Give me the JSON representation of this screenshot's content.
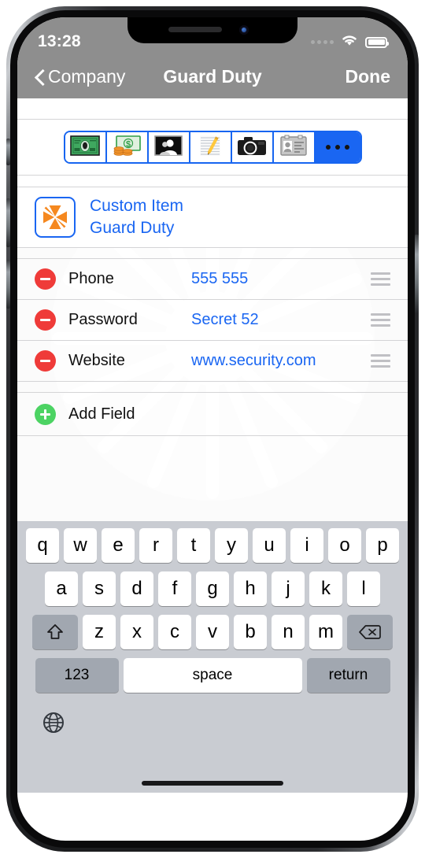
{
  "status_bar": {
    "time": "13:28",
    "signal_icon": "signal-dots-icon",
    "wifi_icon": "wifi-icon",
    "battery_icon": "battery-full-icon"
  },
  "nav_bar": {
    "back_label": "Company",
    "back_icon": "chevron-left-icon",
    "title": "Guard Duty",
    "done_label": "Done"
  },
  "segmented_control": {
    "segments": [
      {
        "name": "banknote-portrait-icon",
        "label": "",
        "selected": false
      },
      {
        "name": "cash-coins-icon",
        "label": "",
        "selected": false
      },
      {
        "name": "portrait-photo-icon",
        "label": "",
        "selected": false
      },
      {
        "name": "notepad-pencil-icon",
        "label": "",
        "selected": false
      },
      {
        "name": "camera-icon",
        "label": "",
        "selected": false
      },
      {
        "name": "id-card-icon",
        "label": "",
        "selected": false
      },
      {
        "name": "more-dots-icon",
        "label": "...",
        "selected": true
      }
    ]
  },
  "custom_item": {
    "icon": "orange-pinwheel-icon",
    "type_label": "Custom Item",
    "name_label": "Guard Duty"
  },
  "fields": {
    "rows": [
      {
        "delete_icon": "minus-circle-icon",
        "label": "Phone",
        "value": "555 555",
        "handle_icon": "reorder-handle-icon"
      },
      {
        "delete_icon": "minus-circle-icon",
        "label": "Password",
        "value": "Secret 52",
        "handle_icon": "reorder-handle-icon"
      },
      {
        "delete_icon": "minus-circle-icon",
        "label": "Website",
        "value": "www.security.com",
        "handle_icon": "reorder-handle-icon"
      }
    ],
    "add_field": {
      "icon": "plus-circle-icon",
      "label": "Add Field"
    }
  },
  "keyboard": {
    "row1": [
      "q",
      "w",
      "e",
      "r",
      "t",
      "y",
      "u",
      "i",
      "o",
      "p"
    ],
    "row2": [
      "a",
      "s",
      "d",
      "f",
      "g",
      "h",
      "j",
      "k",
      "l"
    ],
    "row3": [
      "z",
      "x",
      "c",
      "v",
      "b",
      "n",
      "m"
    ],
    "shift_icon": "shift-arrow-icon",
    "backspace_icon": "backspace-icon",
    "numbers_label": "123",
    "space_label": "space",
    "return_label": "return",
    "globe_icon": "globe-icon"
  },
  "colors": {
    "accent_blue": "#1a66f2",
    "nav_grey": "#8e8e8e",
    "delete_red": "#ef3b39",
    "add_green": "#4cd363",
    "keyboard_bg": "#c9ccd2",
    "pinwheel_orange": "#f5881f"
  }
}
